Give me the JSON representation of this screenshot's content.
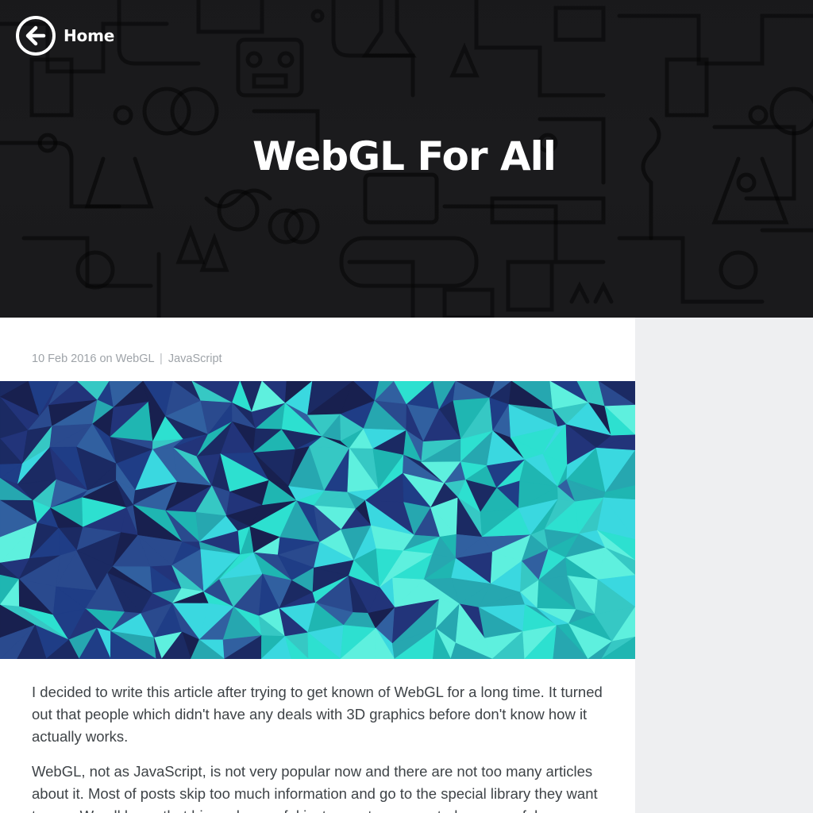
{
  "header": {
    "home_label": "Home",
    "title": "WebGL For All"
  },
  "post": {
    "date": "10 Feb 2016",
    "on": "on",
    "tags": [
      "WebGL",
      "JavaScript"
    ],
    "tag_separator": "|",
    "paragraphs": [
      "I decided to write this article after trying to get known of WebGL for a long time. It turned out that people which didn't have any deals with 3D graphics before don't know how it actually works.",
      "WebGL, not as JavaScript, is not very popular now and there are not too many articles about it. Most of posts skip too much information and go to the special library they want to use. We all know that big and powerful instruments are created on powerful"
    ]
  },
  "icons": {
    "back": "arrow-left-circle-icon"
  },
  "colors": {
    "hero_bg": "#1c1c1e",
    "sidebar_bg": "#eeeff1",
    "meta_text": "#9ea3a8",
    "body_text": "#3e4347",
    "cover_dark": "#1c2f6b",
    "cover_teal": "#2de0d0"
  }
}
